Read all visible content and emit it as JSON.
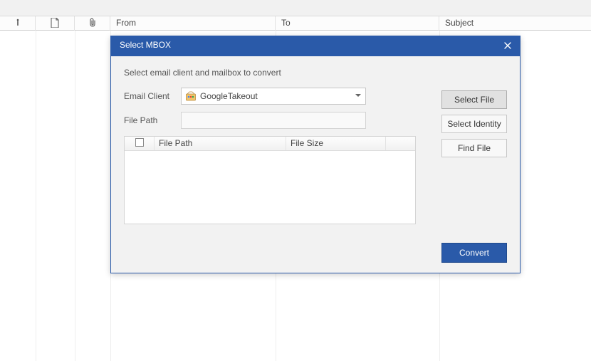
{
  "columns": {
    "from": "From",
    "to": "To",
    "subject": "Subject"
  },
  "dialog": {
    "title": "Select MBOX",
    "instruction": "Select email client and mailbox to convert",
    "email_client_label": "Email Client",
    "file_path_label": "File Path",
    "combo_value": "GoogleTakeout",
    "select_file": "Select File",
    "select_identity": "Select Identity",
    "find_file": "Find File",
    "table": {
      "file_path": "File Path",
      "file_size": "File Size"
    },
    "convert": "Convert"
  }
}
